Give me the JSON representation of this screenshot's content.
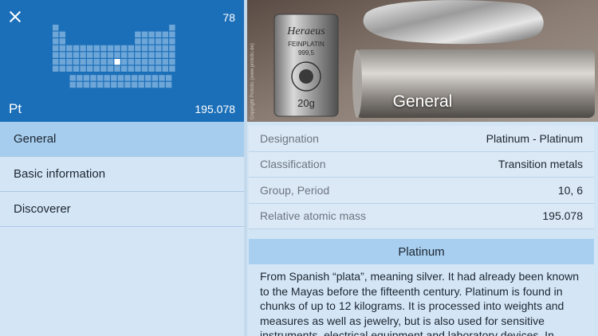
{
  "element": {
    "atomic_number": "78",
    "symbol": "Pt",
    "relative_mass": "195.078"
  },
  "menu": {
    "items": [
      {
        "label": "General",
        "active": true
      },
      {
        "label": "Basic information",
        "active": false
      },
      {
        "label": "Discoverer",
        "active": false
      }
    ]
  },
  "hero": {
    "title": "General",
    "image_text": {
      "brand": "Heraeus",
      "line1": "FEINPLATIN",
      "line2": "999,5",
      "weight": "20g",
      "credit": "Copyright Prototic (www.prototic.de)"
    }
  },
  "info": {
    "rows": [
      {
        "key": "Designation",
        "value": "Platinum - Platinum"
      },
      {
        "key": "Classification",
        "value": "Transition metals"
      },
      {
        "key": "Group, Period",
        "value": "10, 6"
      },
      {
        "key": "Relative atomic mass",
        "value": "195.078"
      }
    ]
  },
  "description": {
    "title": "Platinum",
    "body": "From Spanish “plata”, meaning silver. It had already been known to the Mayas before the fifteenth century. Platinum is found in chunks of up to 12 kilograms. It is processed into weights and measures as well as jewelry, but is also used for sensitive instruments, electrical equipment and laboratory devices. In"
  },
  "colors": {
    "header_bg": "#1b6fb8",
    "menu_active": "#a6cdee",
    "pane_bg": "#d4e6f6",
    "description_header": "#a9cff0"
  }
}
